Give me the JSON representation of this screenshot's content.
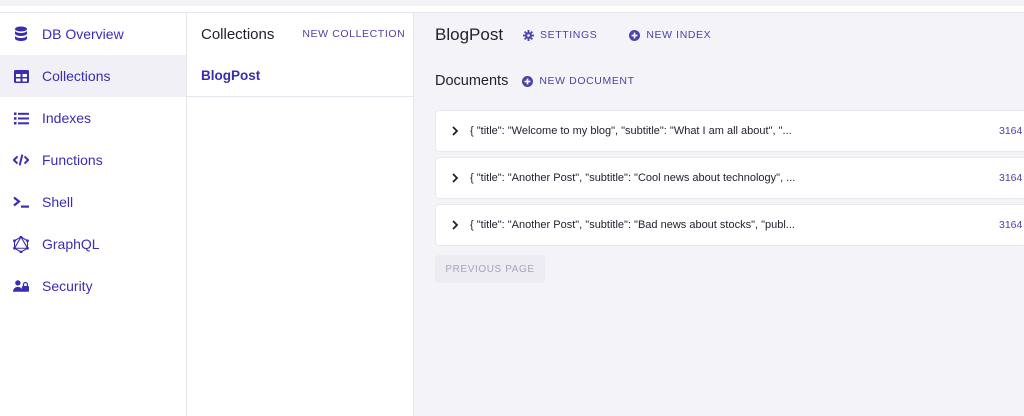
{
  "colors": {
    "accent": "#3a2db0",
    "active_bg": "#f0f0f6",
    "main_bg": "#f4f4f8"
  },
  "sidebar": {
    "items": [
      {
        "label": "DB Overview",
        "icon": "database-icon"
      },
      {
        "label": "Collections",
        "icon": "table-icon",
        "active": true
      },
      {
        "label": "Indexes",
        "icon": "list-icon"
      },
      {
        "label": "Functions",
        "icon": "code-icon"
      },
      {
        "label": "Shell",
        "icon": "terminal-icon"
      },
      {
        "label": "GraphQL",
        "icon": "graphql-icon"
      },
      {
        "label": "Security",
        "icon": "users-lock-icon"
      }
    ]
  },
  "collections": {
    "title": "Collections",
    "new_label": "NEW COLLECTION",
    "items": [
      "BlogPost"
    ]
  },
  "main": {
    "title": "BlogPost",
    "settings_label": "SETTINGS",
    "new_index_label": "NEW INDEX",
    "documents_title": "Documents",
    "new_document_label": "NEW DOCUMENT",
    "documents": [
      {
        "preview": "{ \"title\": \"Welcome to my blog\", \"subtitle\": \"What I am all about\", \"...",
        "id": "3164"
      },
      {
        "preview": "{ \"title\": \"Another Post\", \"subtitle\": \"Cool news about technology\", ...",
        "id": "3164"
      },
      {
        "preview": "{ \"title\": \"Another Post\", \"subtitle\": \"Bad news about stocks\", \"publ...",
        "id": "3164"
      }
    ],
    "previous_page_label": "PREVIOUS PAGE"
  }
}
